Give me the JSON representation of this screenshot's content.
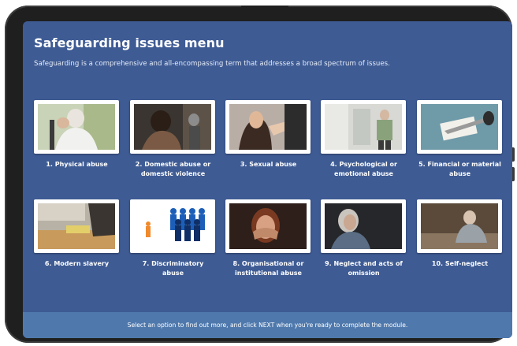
{
  "header": {
    "title": "Safeguarding issues menu",
    "subtitle": "Safeguarding is a comprehensive and all-encompassing term that addresses a broad spectrum of issues."
  },
  "options": [
    {
      "label": "1. Physical abuse",
      "icon": "physical-abuse-photo"
    },
    {
      "label": "2. Domestic abuse or domestic violence",
      "icon": "domestic-abuse-photo"
    },
    {
      "label": "3. Sexual abuse",
      "icon": "sexual-abuse-photo"
    },
    {
      "label": "4. Psychological or emotional abuse",
      "icon": "psychological-abuse-photo"
    },
    {
      "label": "5. Financial or material abuse",
      "icon": "financial-abuse-photo"
    },
    {
      "label": "6. Modern slavery",
      "icon": "modern-slavery-photo"
    },
    {
      "label": "7. Discriminatory abuse",
      "icon": "discriminatory-abuse-photo"
    },
    {
      "label": "8. Organisational or institutional abuse",
      "icon": "organisational-abuse-photo"
    },
    {
      "label": "9. Neglect and acts of omission",
      "icon": "neglect-photo"
    },
    {
      "label": "10. Self-neglect",
      "icon": "self-neglect-photo"
    }
  ],
  "footer": {
    "instruction": "Select an option to find out more, and click NEXT when you're ready to complete the module."
  },
  "colors": {
    "screen_background": "#3e5b94",
    "footer_bar": "#4f79ad",
    "text": "#ffffff"
  }
}
